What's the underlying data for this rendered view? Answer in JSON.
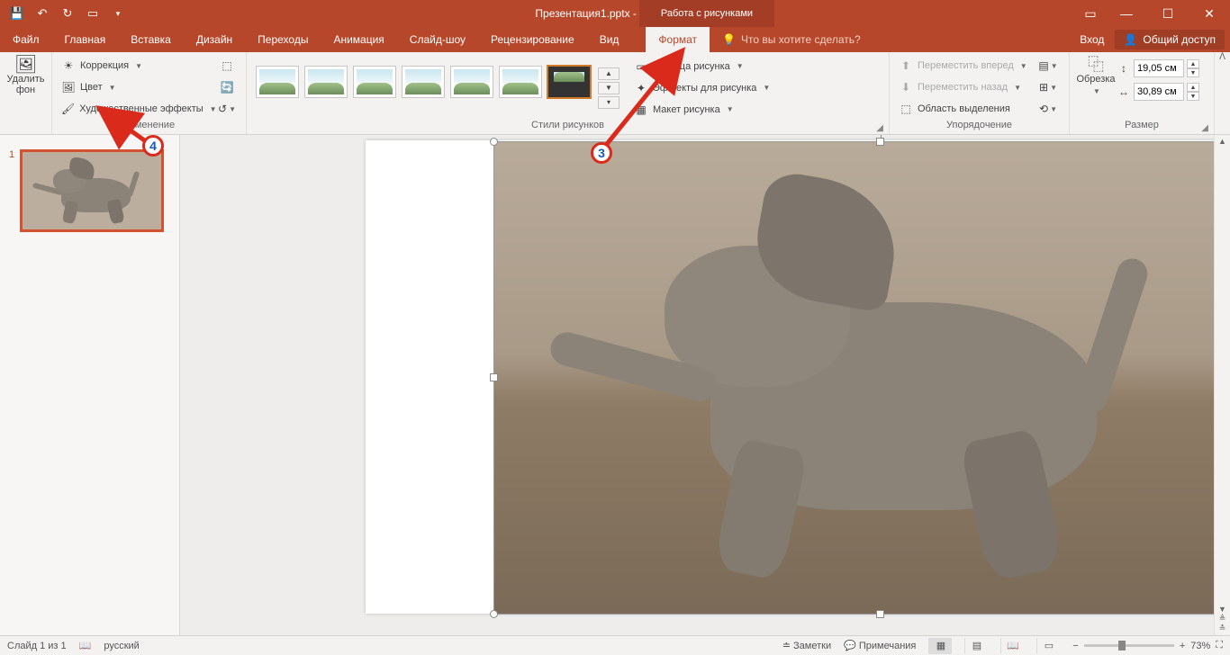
{
  "titlebar": {
    "title": "Презентация1.pptx - PowerPoint",
    "context_tab": "Работа с рисунками"
  },
  "tabs": {
    "file": "Файл",
    "home": "Главная",
    "insert": "Вставка",
    "design": "Дизайн",
    "transitions": "Переходы",
    "animation": "Анимация",
    "slideshow": "Слайд-шоу",
    "review": "Рецензирование",
    "view": "Вид",
    "format": "Формат",
    "tellme": "Что вы хотите сделать?",
    "signin": "Вход",
    "share": "Общий доступ"
  },
  "ribbon": {
    "remove_bg": "Удалить фон",
    "corrections": "Коррекция",
    "color": "Цвет",
    "artistic": "Художественные эффекты",
    "group_adjust": "Изменение",
    "group_styles": "Стили рисунков",
    "border": "Граница рисунка",
    "effects": "Эффекты для рисунка",
    "layout": "Макет рисунка",
    "bring_forward": "Переместить вперед",
    "send_backward": "Переместить назад",
    "selection_pane": "Область выделения",
    "group_arrange": "Упорядочение",
    "crop": "Обрезка",
    "group_size": "Размер",
    "height": "19,05 см",
    "width": "30,89 см"
  },
  "thumb": {
    "num": "1"
  },
  "status": {
    "slide": "Слайд 1 из 1",
    "lang": "русский",
    "notes": "Заметки",
    "comments": "Примечания",
    "zoom": "73%"
  },
  "annotations": {
    "b3": "3",
    "b4": "4"
  }
}
